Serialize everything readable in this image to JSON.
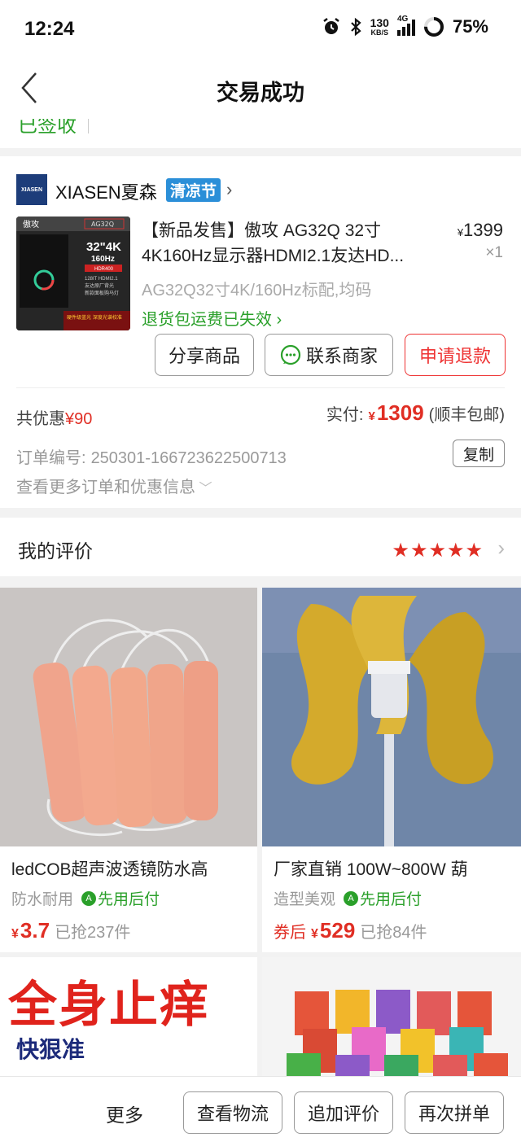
{
  "status": {
    "time": "12:24",
    "net_speed_top": "130",
    "net_speed_unit": "KB/S",
    "net_type": "4G",
    "battery": "75%"
  },
  "nav": {
    "title": "交易成功"
  },
  "order_status": {
    "label": "已签收"
  },
  "shop": {
    "logo_text": "XIASEN",
    "name": "XIASEN夏森",
    "tag": "清凉节"
  },
  "product": {
    "image_texts": [
      "傲攻",
      "AG32Q",
      "32\"4K",
      "160Hz",
      "HDR400",
      "128IT HDMI2.1",
      "友达原厂背光",
      "新款面板购马灯",
      "硬件级蓝光",
      "深度光谱校准"
    ],
    "title": "【新品发售】傲攻 AG32Q 32寸4K160Hz显示器HDMI2.1友达HD...",
    "currency": "¥",
    "price": "1399",
    "qty": "×1",
    "spec": "AG32Q32寸4K/160Hz标配,均码",
    "return_note": "退货包运费已失效"
  },
  "actions": {
    "share": "分享商品",
    "contact": "联系商家",
    "refund": "申请退款"
  },
  "payment": {
    "discount_label": "共优惠",
    "discount_value": "¥90",
    "paid_label": "实付:",
    "paid_currency": "¥",
    "paid_value": "1309",
    "shipping_note": "(顺丰包邮)"
  },
  "order_info": {
    "order_no_label": "订单编号:",
    "order_no": "250301-166723622500713",
    "copy": "复制",
    "more_info": "查看更多订单和优惠信息"
  },
  "review": {
    "label": "我的评价",
    "stars": "★★★★★",
    "rating": 5
  },
  "feed": [
    {
      "title": "ledCOB超声波透镜防水高",
      "tag": "防水耐用",
      "pay_tag": "先用后付",
      "price_prefix": "",
      "currency": "¥",
      "price": "3.7",
      "sold": "已抢237件"
    },
    {
      "title": "厂家直销 100W~800W 葫",
      "tag": "造型美观",
      "pay_tag": "先用后付",
      "price_prefix": "券后",
      "currency": "¥",
      "price": "529",
      "sold": "已抢84件"
    },
    {
      "image_title": "全身止痒",
      "image_subtitle": "快狠准"
    }
  ],
  "bottom": {
    "more": "更多",
    "logistics": "查看物流",
    "add_review": "追加评价",
    "regroup": "再次拼单"
  },
  "colors": {
    "accent_red": "#e02e24",
    "green": "#2aa02a",
    "tag_blue": "#2b8fd8"
  }
}
